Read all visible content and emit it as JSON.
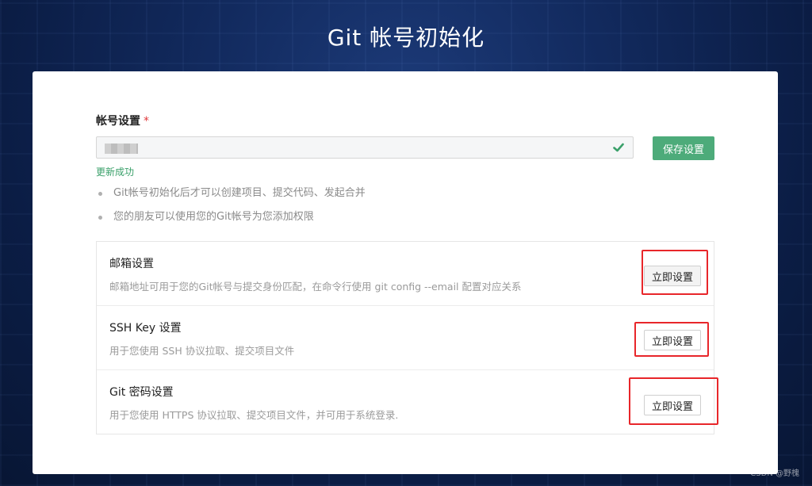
{
  "page": {
    "title": "Git 帐号初始化"
  },
  "account": {
    "label": "帐号设置",
    "required_mark": "*",
    "input_value": "",
    "save_label": "保存设置",
    "status": "更新成功",
    "tips": [
      "Git帐号初始化后才可以创建项目、提交代码、发起合并",
      "您的朋友可以使用您的Git帐号为您添加权限"
    ]
  },
  "settings": [
    {
      "title": "邮箱设置",
      "desc": "邮箱地址可用于您的Git帐号与提交身份匹配，在命令行使用 git config --email 配置对应关系",
      "button": "立即设置"
    },
    {
      "title": "SSH Key 设置",
      "desc": "用于您使用 SSH 协议拉取、提交项目文件",
      "button": "立即设置"
    },
    {
      "title": "Git 密码设置",
      "desc": "用于您使用 HTTPS 协议拉取、提交项目文件，并可用于系统登录.",
      "button": "立即设置"
    }
  ],
  "watermark": "CSDN @野槐",
  "colors": {
    "accent_green": "#4dab7a",
    "success_text": "#3aa06a",
    "highlight_red": "#e8262a",
    "background_navy": "#122a5e"
  },
  "icons": {
    "input_status": "check-icon"
  }
}
